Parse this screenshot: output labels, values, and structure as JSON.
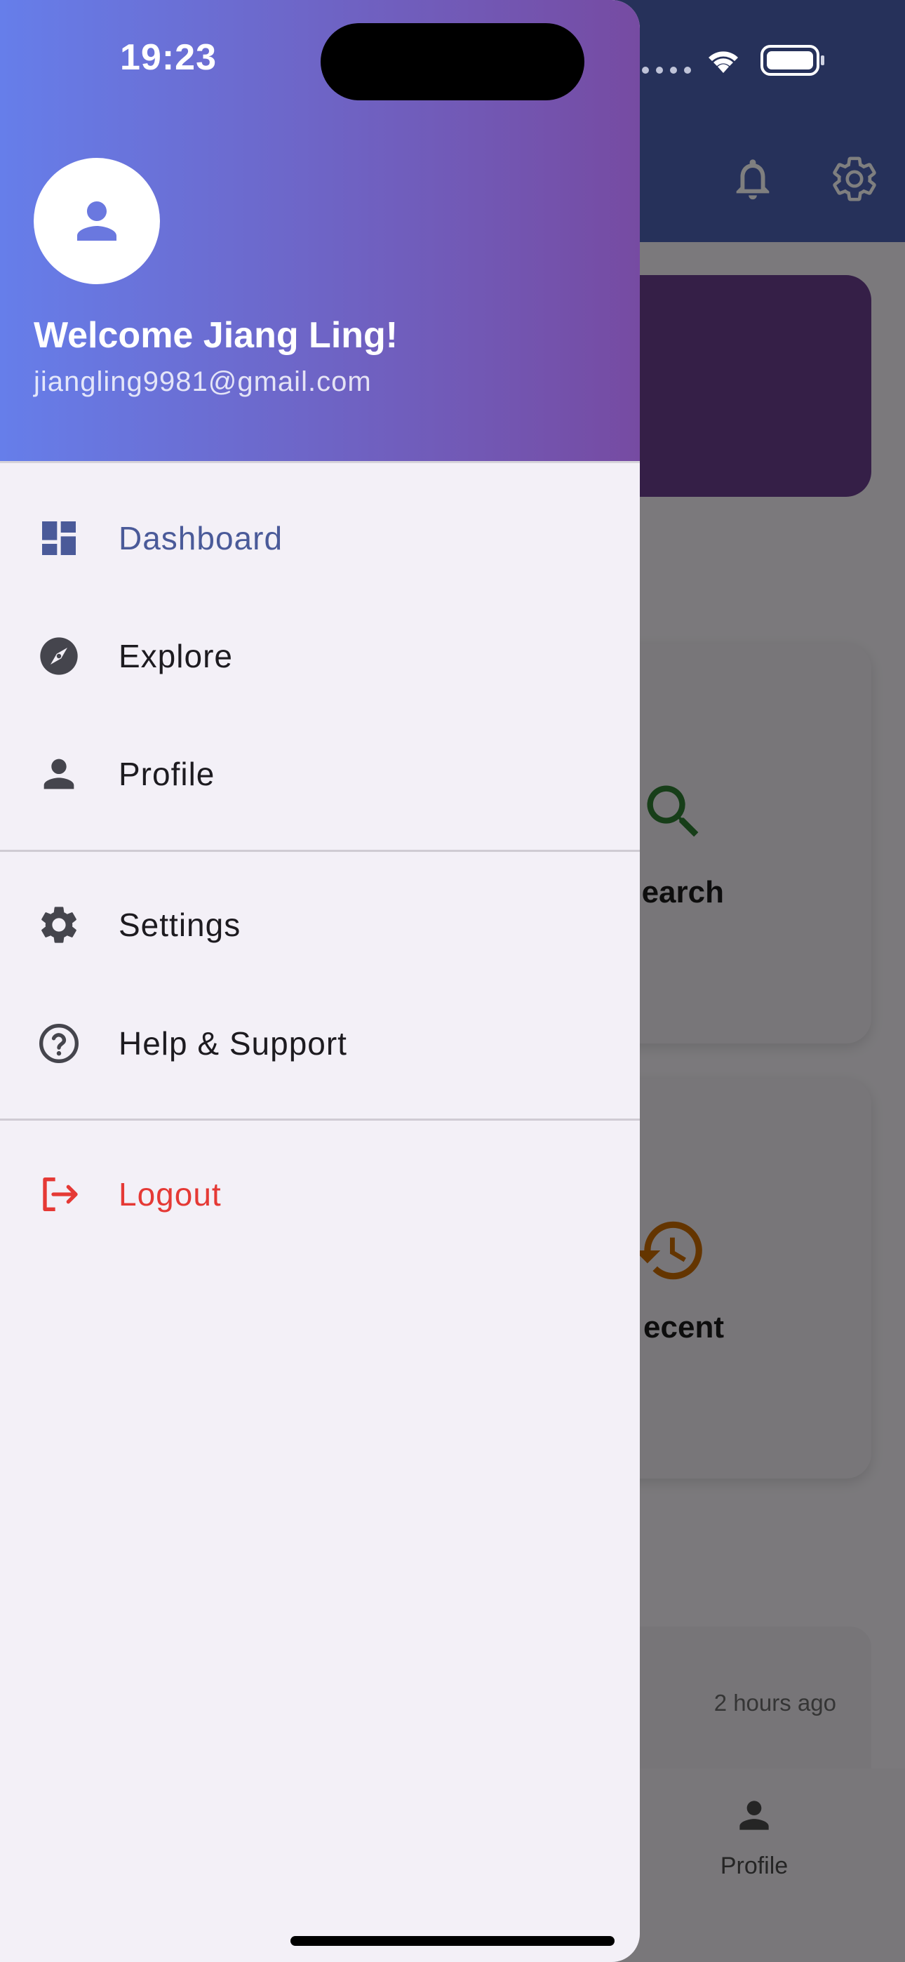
{
  "status_bar": {
    "time": "19:23"
  },
  "background": {
    "cards": [
      {
        "label": "earch",
        "icon": "search-icon",
        "color": "#2e7d32"
      },
      {
        "label": "ecent",
        "icon": "history-icon",
        "color": "#c96a00"
      }
    ],
    "activity_time": "2 hours ago",
    "bottom_nav_profile_label": "Profile"
  },
  "drawer": {
    "header": {
      "welcome": "Welcome Jiang Ling!",
      "email": "jiangling9981@gmail.com"
    },
    "items": [
      {
        "label": "Dashboard",
        "icon": "dashboard-icon",
        "selected": true
      },
      {
        "label": "Explore",
        "icon": "compass-icon"
      },
      {
        "label": "Profile",
        "icon": "person-icon"
      },
      {
        "label": "Settings",
        "icon": "gear-icon"
      },
      {
        "label": "Help & Support",
        "icon": "help-circle-icon"
      },
      {
        "label": "Logout",
        "icon": "logout-icon"
      }
    ]
  },
  "colors": {
    "header_gradient_start": "#667eea",
    "header_gradient_end": "#764ba2",
    "selected": "#4a5a99",
    "logout": "#e53935",
    "icon_default": "#45454d"
  }
}
